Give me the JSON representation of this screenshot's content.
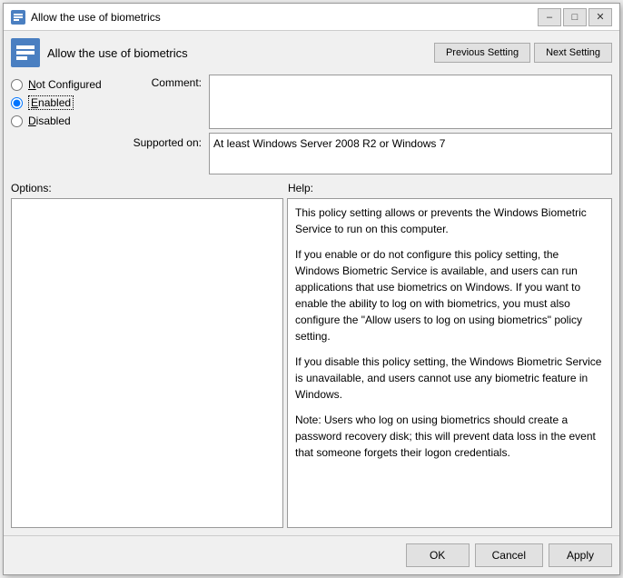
{
  "window": {
    "title": "Allow the use of biometrics",
    "icon_label": "GP"
  },
  "header": {
    "title": "Allow the use of biometrics",
    "prev_btn": "Previous Setting",
    "next_btn": "Next Setting"
  },
  "radio_options": [
    {
      "id": "not-configured",
      "label": "Not Configured",
      "checked": false,
      "underline_char": "N"
    },
    {
      "id": "enabled",
      "label": "Enabled",
      "checked": true,
      "underline_char": "E"
    },
    {
      "id": "disabled",
      "label": "Disabled",
      "checked": false,
      "underline_char": "D"
    }
  ],
  "comment": {
    "label": "Comment:",
    "value": ""
  },
  "supported": {
    "label": "Supported on:",
    "value": "At least Windows Server 2008 R2 or Windows 7"
  },
  "panels": {
    "options_label": "Options:",
    "help_label": "Help:",
    "help_text": [
      "This policy setting allows or prevents the Windows Biometric Service to run on this computer.",
      "If you enable or do not configure this policy setting, the Windows Biometric Service is available, and users can run applications that use biometrics on Windows. If you want to enable the ability to log on with biometrics, you must also configure the \"Allow users to log on using biometrics\" policy setting.",
      "If you disable this policy setting, the Windows Biometric Service is unavailable, and users cannot use any biometric feature in Windows.",
      "Note: Users who log on using biometrics should create a password recovery disk; this will prevent data loss in the event that someone forgets their logon credentials."
    ]
  },
  "footer": {
    "ok_label": "OK",
    "cancel_label": "Cancel",
    "apply_label": "Apply"
  },
  "title_controls": {
    "minimize": "–",
    "maximize": "□",
    "close": "✕"
  }
}
